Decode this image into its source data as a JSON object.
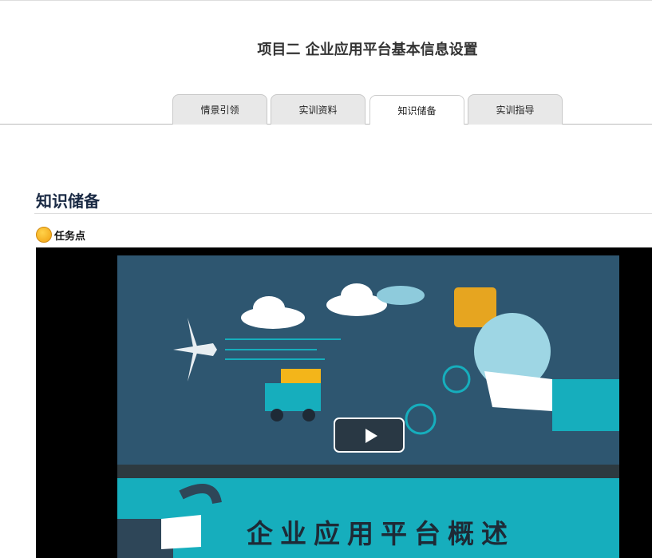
{
  "page_title": "项目二 企业应用平台基本信息设置",
  "tabs": [
    {
      "label": "情景引领",
      "active": false
    },
    {
      "label": "实训资料",
      "active": false
    },
    {
      "label": "知识储备",
      "active": true
    },
    {
      "label": "实训指导",
      "active": false
    }
  ],
  "section_heading": "知识储备",
  "task_label": "任务点",
  "video": {
    "title": "企业应用平台概述"
  },
  "colors": {
    "video_top": "#2e5670",
    "video_bottom": "#16aebd",
    "task_dot": "#f5b020"
  }
}
